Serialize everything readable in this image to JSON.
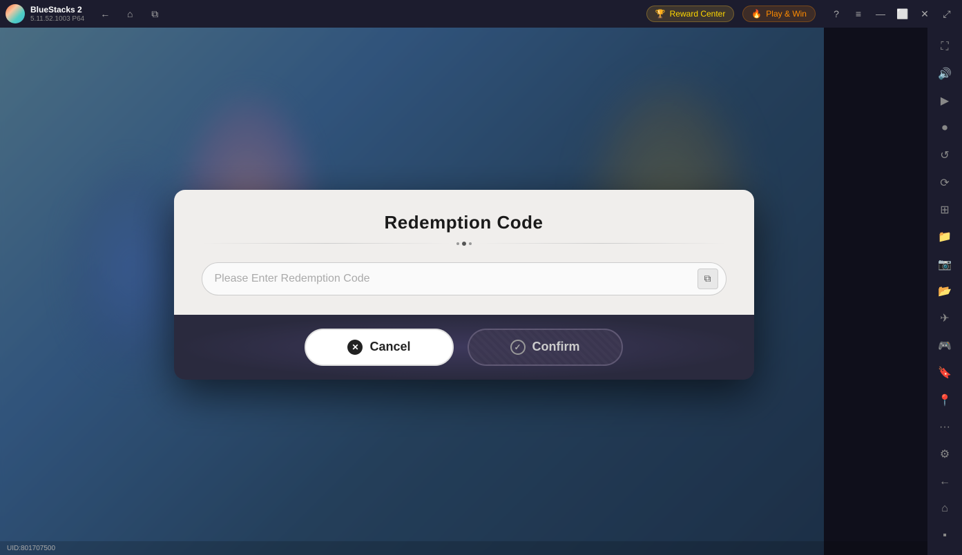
{
  "app": {
    "name": "BlueStacks 2",
    "version": "5.11.52.1003  P64",
    "logo_alt": "bluestacks-logo"
  },
  "titlebar": {
    "back_label": "←",
    "home_label": "⌂",
    "tabs_label": "⧉",
    "reward_center_label": "Reward Center",
    "play_win_label": "Play & Win",
    "help_label": "?",
    "menu_label": "≡",
    "minimize_label": "—",
    "maximize_label": "⬜",
    "close_label": "✕",
    "expand_label": "⤢"
  },
  "right_sidebar": {
    "icons": [
      {
        "name": "fullscreen-icon",
        "symbol": "⛶"
      },
      {
        "name": "volume-icon",
        "symbol": "🔊"
      },
      {
        "name": "video-icon",
        "symbol": "▶"
      },
      {
        "name": "camera-icon",
        "symbol": "📷"
      },
      {
        "name": "refresh-icon",
        "symbol": "↺"
      },
      {
        "name": "rotation-icon",
        "symbol": "⟳"
      },
      {
        "name": "apps-icon",
        "symbol": "⊞"
      },
      {
        "name": "media-icon",
        "symbol": "📁"
      },
      {
        "name": "screenshot-icon",
        "symbol": "📸"
      },
      {
        "name": "folder-icon",
        "symbol": "📂"
      },
      {
        "name": "airplane-icon",
        "symbol": "✈"
      },
      {
        "name": "gamepad-icon",
        "symbol": "🎮"
      },
      {
        "name": "bookmark-icon",
        "symbol": "🔖"
      },
      {
        "name": "location-icon",
        "symbol": "📍"
      },
      {
        "name": "more-icon",
        "symbol": "•••"
      },
      {
        "name": "settings-icon",
        "symbol": "⚙"
      },
      {
        "name": "back-arrow-icon",
        "symbol": "←"
      },
      {
        "name": "home-bottom-icon",
        "symbol": "⌂"
      },
      {
        "name": "layers-icon",
        "symbol": "⬛"
      }
    ]
  },
  "dialog": {
    "title": "Redemption Code",
    "input_placeholder": "Please Enter Redemption Code",
    "cancel_label": "Cancel",
    "confirm_label": "Confirm"
  },
  "bottom_bar": {
    "uid_label": "UID:801707500"
  }
}
